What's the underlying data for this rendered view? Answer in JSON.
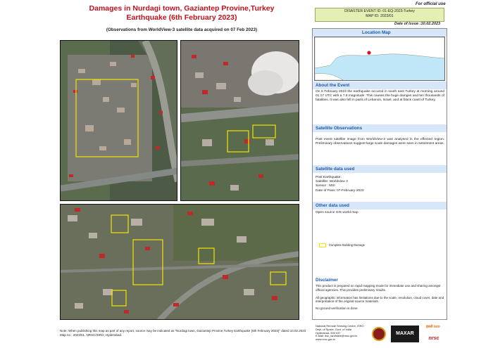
{
  "header": {
    "title_line1": "Damages in Nurdagi town, Gaziantep Provine,Turkey",
    "title_line2": "Earthquake (6th February 2023)",
    "subtitle": "(Observations from WorldView-3 satellite data acquired on 07 Feb 2023)",
    "official": "For official use",
    "event_id": "DISASTER EVENT ID: 01-EQ-2023-Turkey",
    "map_id": "MAP ID: 2023/01",
    "issue_date": "Date of Issue :10.02.2023"
  },
  "location_map": {
    "title": "Location Map",
    "land_color": "#ffffff",
    "sea_color": "#bfe7f7",
    "marker_color": "#e01020"
  },
  "about": {
    "title": "About the Event",
    "text": "On 6 February 2023 the earthquake occured in south east  Turkey at morning around 01.17 UTC with a 7.8 magnitude. This causes the huge damges and ten thousands of fatalities. It was also felt in parts of Lebanon, Israel, and at black coast of Turkey."
  },
  "observations": {
    "title": "Satellite Observations",
    "text": "Post     event     satellite     image     from     WorldView-3 was   analysed   in   the   effected   region.   Preliminary observations suggest large scale damages were seen in settelment areas."
  },
  "satellite": {
    "title": "Satellite data used",
    "lines": [
      "Post Earthquake:",
      "Satellite: Worldview 3",
      "Sensor : MSI",
      "Date of Pass: 07-February-2023"
    ]
  },
  "other": {
    "title": "Other data used",
    "text": "Open source GIS world map"
  },
  "legend": {
    "label": "Complete Building Damage",
    "color": "#f2e600"
  },
  "disclaimer": {
    "title": "Disclaimer",
    "p1": "This product is prepared on rapid mapping mode for immediate use and sharing amongst official agencies. This provides preliminary results.",
    "p2": "All geographic information has limitations due to the scale, resolution, cloud cover, date and interpretation of the original source materials.",
    "p3": "No ground verification is done."
  },
  "org": {
    "lines": [
      "National Remote Sensing Centre, ISRO",
      "Dept. of Space, Govt. of India",
      "Hyderabad- 500 037",
      "E-Mail: dsc_landslide@nrsc.gov.in",
      "www.nrsc.gov.in"
    ],
    "maxar": "MAXAR",
    "isro": "इसरो isro",
    "nrsc": "nrsc"
  },
  "note": {
    "text": "Note: When publishing this map as part of any report, source may be indicated as \"Nurdagi town, Gaziantep Provine,Turkey Earthquake (6th February 2023)\" dated 10.02.2023 Map no : 2023/01, NRSC/ISRO, Hyderabad."
  }
}
